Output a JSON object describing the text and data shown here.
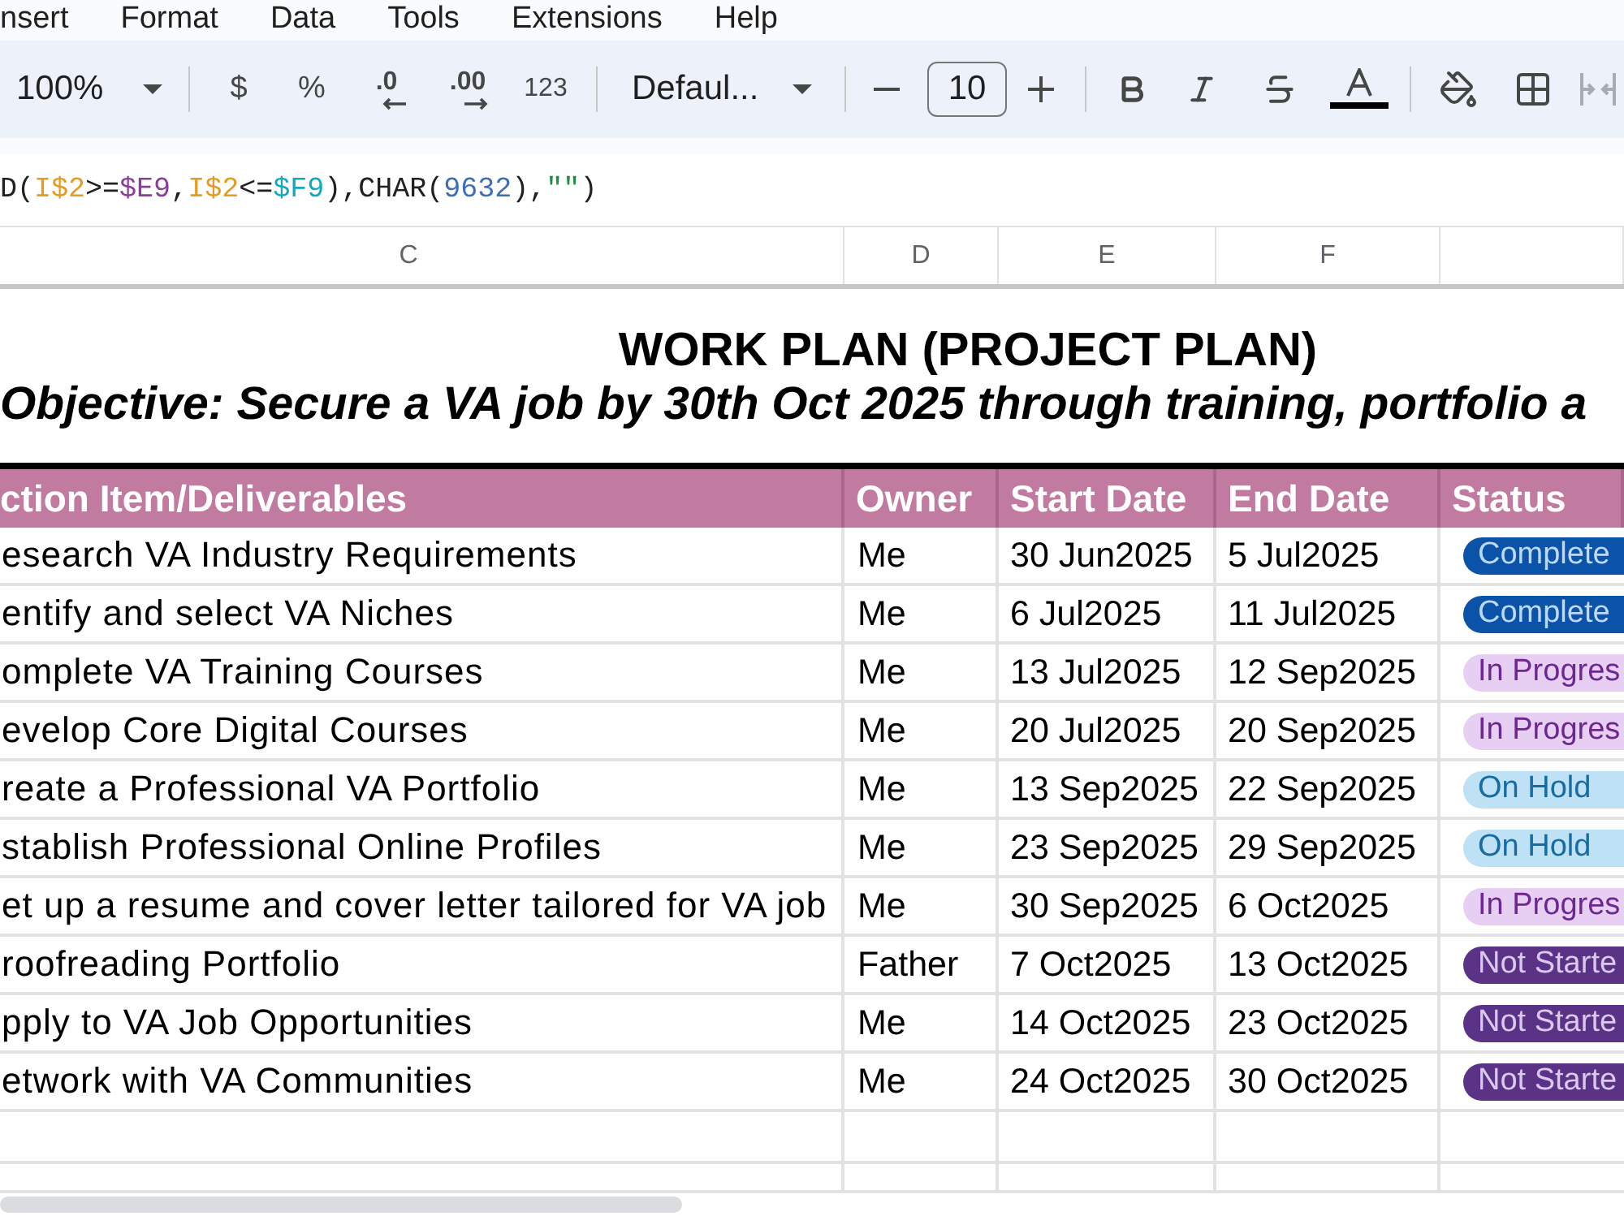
{
  "menu_bar": [
    "nsert",
    "Format",
    "Data",
    "Tools",
    "Extensions",
    "Help"
  ],
  "toolbar": {
    "zoom": "100%",
    "number_formats": [
      {
        "label": "$",
        "kind": "plain"
      },
      {
        "label": "%",
        "kind": "plain"
      },
      {
        "label": ".0",
        "kind": "decrease_decimal"
      },
      {
        "label": ".00",
        "kind": "increase_decimal"
      },
      {
        "label": "123",
        "kind": "plain"
      }
    ],
    "font": "Defaul...",
    "font_size": "10"
  },
  "formula_bar": {
    "segments": [
      {
        "text": "D(",
        "color": "#202124"
      },
      {
        "text": "I$2",
        "color": "#e69b1e"
      },
      {
        "text": ">=",
        "color": "#202124"
      },
      {
        "text": "$E9",
        "color": "#8a3d9c"
      },
      {
        "text": ",",
        "color": "#202124"
      },
      {
        "text": "I$2",
        "color": "#e69b1e"
      },
      {
        "text": "<=",
        "color": "#202124"
      },
      {
        "text": "$F9",
        "color": "#11a9bf"
      },
      {
        "text": "),CHAR(",
        "color": "#202124"
      },
      {
        "text": "9632",
        "color": "#3c6fb5"
      },
      {
        "text": "),",
        "color": "#202124"
      },
      {
        "text": "\"\"",
        "color": "#1e8e3e"
      },
      {
        "text": ")",
        "color": "#202124"
      }
    ]
  },
  "column_letters": [
    "C",
    "D",
    "E",
    "F"
  ],
  "sheet": {
    "title": "WORK PLAN (PROJECT PLAN)",
    "objective": "Objective: Secure a VA job by 30th Oct 2025 through training, portfolio a",
    "table": {
      "columns": [
        "ction Item/Deliverables",
        "Owner",
        "Start Date",
        "End Date",
        "Status"
      ],
      "rows": [
        {
          "item": "esearch VA Industry Requirements",
          "owner": "Me",
          "start": "30 Jun2025",
          "end": "5 Jul2025",
          "status": {
            "label": "Complete",
            "color": "#0a53a8"
          }
        },
        {
          "item": "entify and select VA Niches",
          "owner": "Me",
          "start": "6 Jul2025",
          "end": "11 Jul2025",
          "status": {
            "label": "Complete",
            "color": "#0a53a8"
          }
        },
        {
          "item": "omplete VA Training Courses",
          "owner": "Me",
          "start": "13 Jul2025",
          "end": "12 Sep2025",
          "status": {
            "label": "In Progres",
            "color": "#e6cff2"
          }
        },
        {
          "item": "evelop Core Digital Courses",
          "owner": "Me",
          "start": "20 Jul2025",
          "end": "20 Sep2025",
          "status": {
            "label": "In Progres",
            "color": "#e6cff2"
          }
        },
        {
          "item": "reate a Professional VA Portfolio",
          "owner": "Me",
          "start": "13 Sep2025",
          "end": "22 Sep2025",
          "status": {
            "label": "On Hold",
            "color": "#bfe1f6"
          }
        },
        {
          "item": "stablish Professional Online Profiles",
          "owner": "Me",
          "start": "23 Sep2025",
          "end": "29 Sep2025",
          "status": {
            "label": "On Hold",
            "color": "#bfe1f6"
          }
        },
        {
          "item": "et up a resume and cover letter tailored for VA job",
          "owner": "Me",
          "start": "30 Sep2025",
          "end": "6 Oct2025",
          "status": {
            "label": "In Progres",
            "color": "#e6cff2"
          }
        },
        {
          "item": "roofreading Portfolio",
          "owner": "Father",
          "start": "7 Oct2025",
          "end": "13 Oct2025",
          "status": {
            "label": "Not Starte",
            "color": "#5a3286"
          }
        },
        {
          "item": "pply to VA Job Opportunities",
          "owner": "Me",
          "start": "14 Oct2025",
          "end": "23 Oct2025",
          "status": {
            "label": "Not Starte",
            "color": "#5a3286"
          }
        },
        {
          "item": "etwork with VA Communities",
          "owner": "Me",
          "start": "24 Oct2025",
          "end": "30 Oct2025",
          "status": {
            "label": "Not Starte",
            "color": "#5a3286"
          }
        }
      ]
    }
  }
}
